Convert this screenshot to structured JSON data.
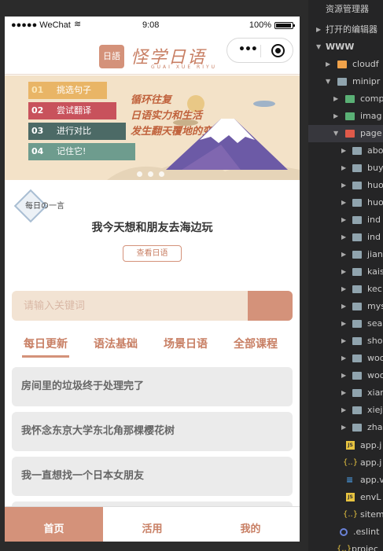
{
  "status_bar": {
    "carrier": "●●●●● WeChat",
    "wifi_icon": "wifi-icon",
    "time": "9:08",
    "battery": "100%"
  },
  "nav": {
    "logo_box": "日語",
    "logo_title": "怪学日语",
    "logo_sub": "GUAI XUE RIYU",
    "capsule_dots": "•••"
  },
  "banner": {
    "steps": [
      {
        "num": "01",
        "text": "挑选句子",
        "color": "#e9b566"
      },
      {
        "num": "02",
        "text": "尝试翻译",
        "color": "#c8525c"
      },
      {
        "num": "03",
        "text": "进行对比",
        "color": "#4c6a66"
      },
      {
        "num": "04",
        "text": "记住它!",
        "color": "#6e9c8e"
      }
    ],
    "slogan_1": "循环往复",
    "slogan_2": "日语实力和生活",
    "slogan_3": "发生翻天覆地的变化"
  },
  "daily": {
    "tag": "每日の一言",
    "quote": "我今天想和朋友去海边玩",
    "button": "查看日语"
  },
  "search": {
    "placeholder": "请输入关键词"
  },
  "tabs": [
    "每日更新",
    "语法基础",
    "场景日语",
    "全部课程"
  ],
  "list": [
    "房间里的垃圾终于处理完了",
    "我怀念东京大学东北角那棵樱花树",
    "我一直想找一个日本女朋友"
  ],
  "tabbar": [
    "首页",
    "活用",
    "我的"
  ],
  "explorer": {
    "title": "资源管理器",
    "open_editors": "打开的编辑器",
    "root": "WWW",
    "items": [
      {
        "label": "cloudf"
      },
      {
        "label": "minipr"
      },
      {
        "label": "comp"
      },
      {
        "label": "imag"
      },
      {
        "label": "page"
      },
      {
        "label": "abo"
      },
      {
        "label": "buy"
      },
      {
        "label": "huo"
      },
      {
        "label": "huo"
      },
      {
        "label": "ind"
      },
      {
        "label": "ind"
      },
      {
        "label": "jian"
      },
      {
        "label": "kais"
      },
      {
        "label": "kec"
      },
      {
        "label": "mys"
      },
      {
        "label": "sea"
      },
      {
        "label": "sho"
      },
      {
        "label": "woo"
      },
      {
        "label": "woo"
      },
      {
        "label": "xian"
      },
      {
        "label": "xiej"
      },
      {
        "label": "zha"
      },
      {
        "label": "app.j"
      },
      {
        "label": "app.j"
      },
      {
        "label": "app.v"
      },
      {
        "label": "envL"
      },
      {
        "label": "sitem"
      },
      {
        "label": ".eslint"
      },
      {
        "label": "projec"
      }
    ]
  }
}
